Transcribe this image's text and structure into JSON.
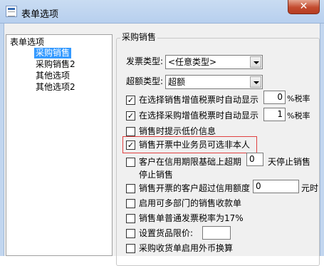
{
  "window": {
    "title": "表单选项",
    "close_label": "✕"
  },
  "tree": {
    "root": "表单选项",
    "items": [
      "采购销售",
      "采购销售2",
      "其他选项",
      "其他选项2"
    ],
    "selected": "采购销售"
  },
  "group": {
    "title": "采购销售",
    "invoice_type": {
      "label": "发票类型:",
      "value": "<任意类型>"
    },
    "excess_type": {
      "label": "超额类型:",
      "value": "超额"
    },
    "options": [
      {
        "label": "在选择销售增值税票时自动显示",
        "checked": true,
        "value": "0",
        "suffix": "%税率"
      },
      {
        "label": "在选择采购增值税票时自动显示",
        "checked": true,
        "value": "1",
        "suffix": "%税率"
      },
      {
        "label": "销售时提示低价信息",
        "checked": false
      },
      {
        "label": "销售开票中业务员可选非本人",
        "checked": true
      },
      {
        "label": "客户在信用期限基础上超期",
        "checked": false,
        "value": "0",
        "suffix": "天停止销售",
        "continuation": "停止销售"
      },
      {
        "label": "销售开票的客户超过信用额度",
        "checked": false,
        "value": "0",
        "suffix": "元时"
      },
      {
        "label": "启用可多部门的销售收款单",
        "checked": false
      },
      {
        "label": "销售单普通发票税率为17%",
        "checked": false
      },
      {
        "label": "设置货品限价:",
        "checked": false,
        "value": ""
      },
      {
        "label": "采购收货单启用外币换算",
        "checked": false
      }
    ]
  }
}
